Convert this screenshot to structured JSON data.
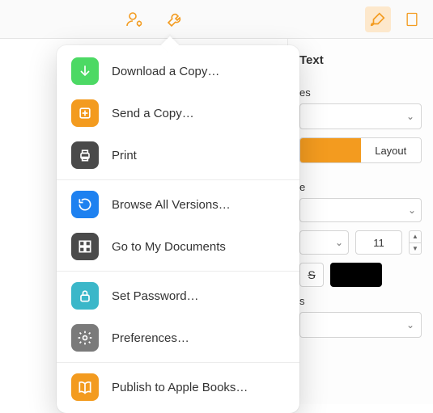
{
  "colors": {
    "accent": "#f39b1f"
  },
  "toolbar": {
    "collaborate_icon": "collaborate-icon",
    "tools_icon": "wrench-icon",
    "format_icon": "brush-icon",
    "document_icon": "document-icon"
  },
  "panel": {
    "tab_text": "Text",
    "section_styles_suffix": "es",
    "seg_layout": "Layout",
    "section_style_suffix": "e",
    "font_size": "11",
    "strike_label": "S",
    "section_s_suffix": "s"
  },
  "menu": {
    "items": [
      {
        "label": "Download a Copy…",
        "icon": "download-icon",
        "color": "ic-green"
      },
      {
        "label": "Send a Copy…",
        "icon": "send-copy-icon",
        "color": "ic-orange"
      },
      {
        "label": "Print",
        "icon": "print-icon",
        "color": "ic-dark"
      },
      {
        "label": "Browse All Versions…",
        "icon": "versions-icon",
        "color": "ic-blue"
      },
      {
        "label": "Go to My Documents",
        "icon": "documents-grid-icon",
        "color": "ic-grid"
      },
      {
        "label": "Set Password…",
        "icon": "lock-icon",
        "color": "ic-teal"
      },
      {
        "label": "Preferences…",
        "icon": "gear-icon",
        "color": "ic-gear"
      },
      {
        "label": "Publish to Apple Books…",
        "icon": "book-icon",
        "color": "ic-book"
      }
    ]
  }
}
